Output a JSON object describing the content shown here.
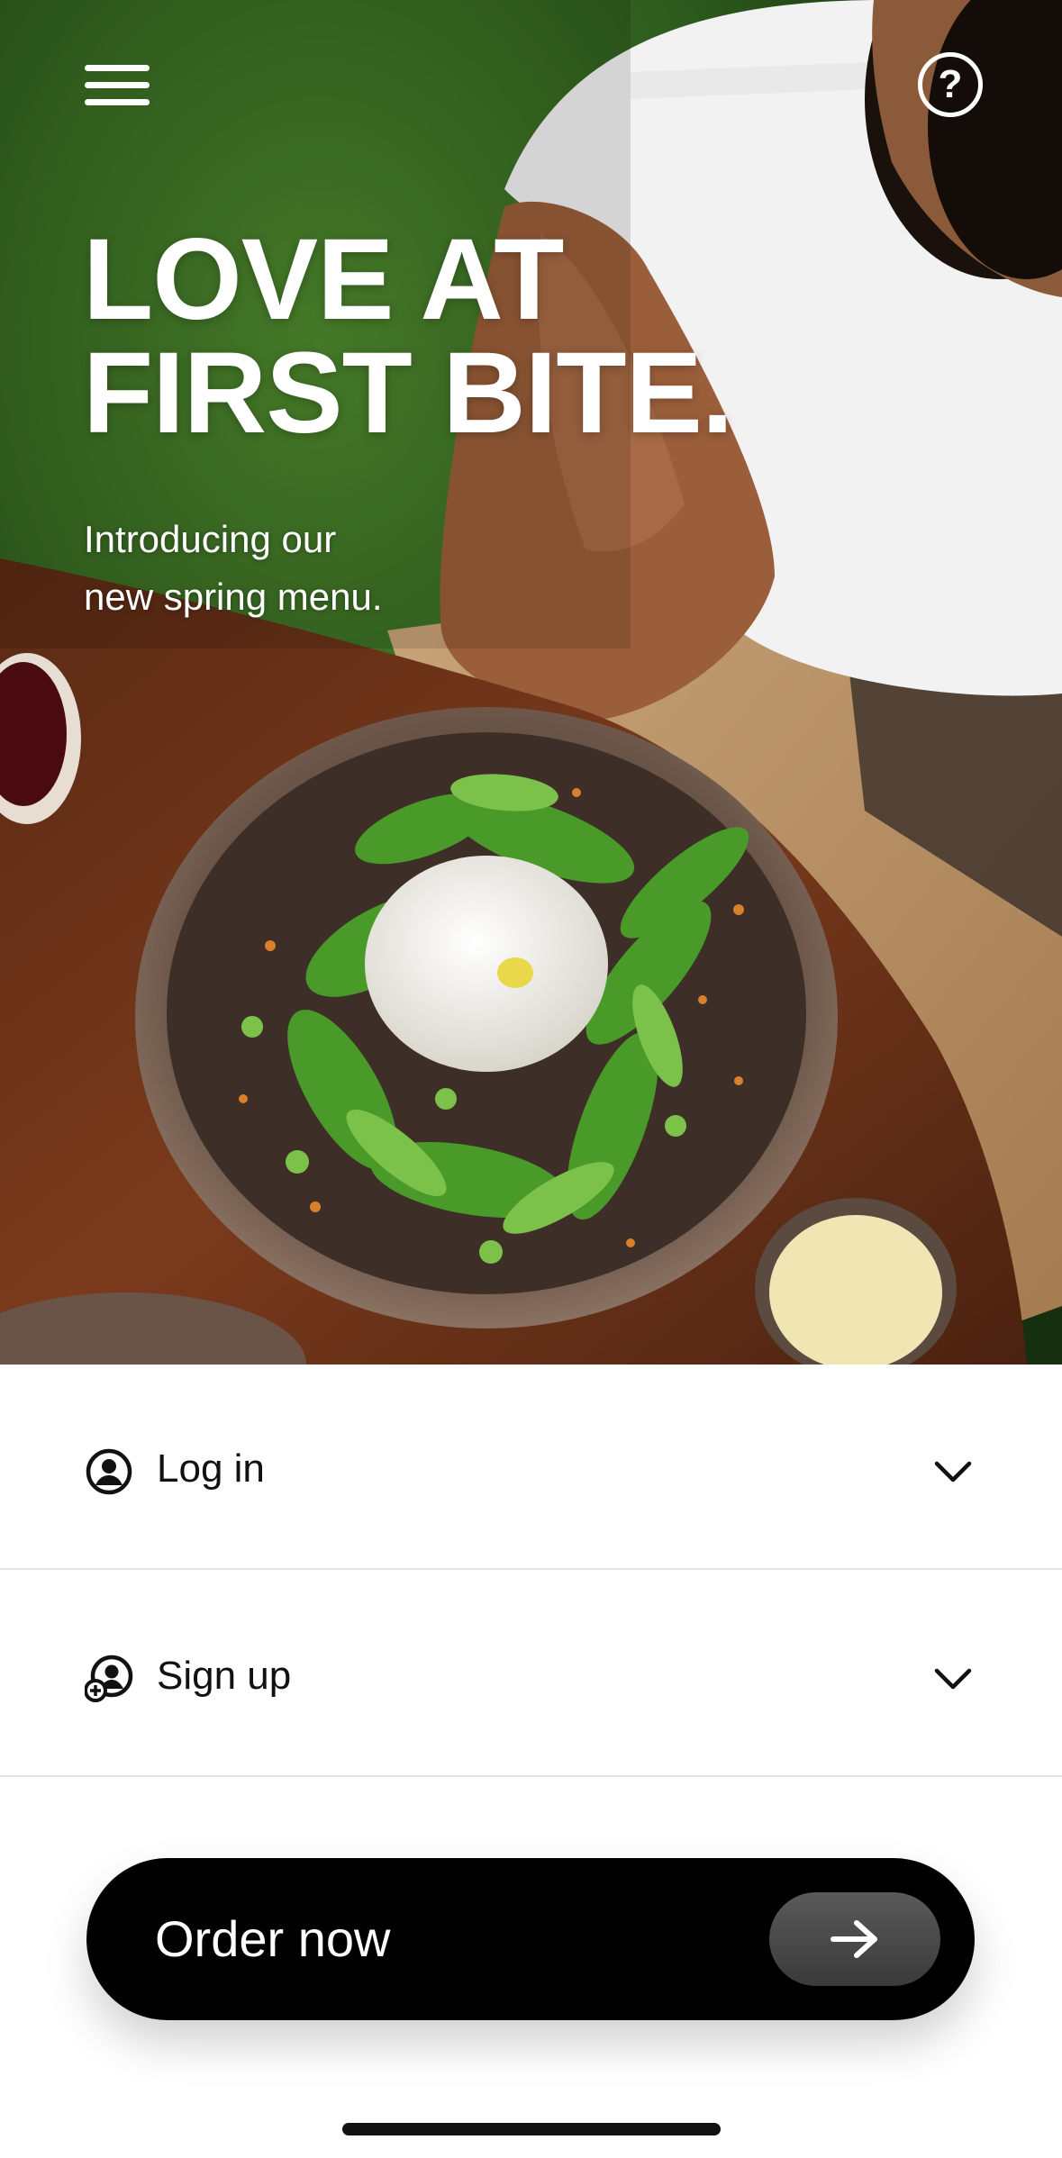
{
  "hero": {
    "title_line1": "LOVE AT",
    "title_line2": "FIRST BITE.",
    "subtitle_line1": "Introducing our",
    "subtitle_line2": "new spring menu.",
    "help_symbol": "?"
  },
  "icons": {
    "menu": "hamburger-menu-icon",
    "help": "question-circle-icon",
    "login": "user-circle-icon",
    "signup": "user-add-icon",
    "chevron": "chevron-down-icon",
    "arrow": "arrow-right-icon"
  },
  "accordion": {
    "login_label": "Log in",
    "signup_label": "Sign up"
  },
  "order": {
    "label": "Order now"
  },
  "colors": {
    "primary_button": "#000000",
    "background": "#ffffff",
    "divider": "#e3e3e3"
  }
}
